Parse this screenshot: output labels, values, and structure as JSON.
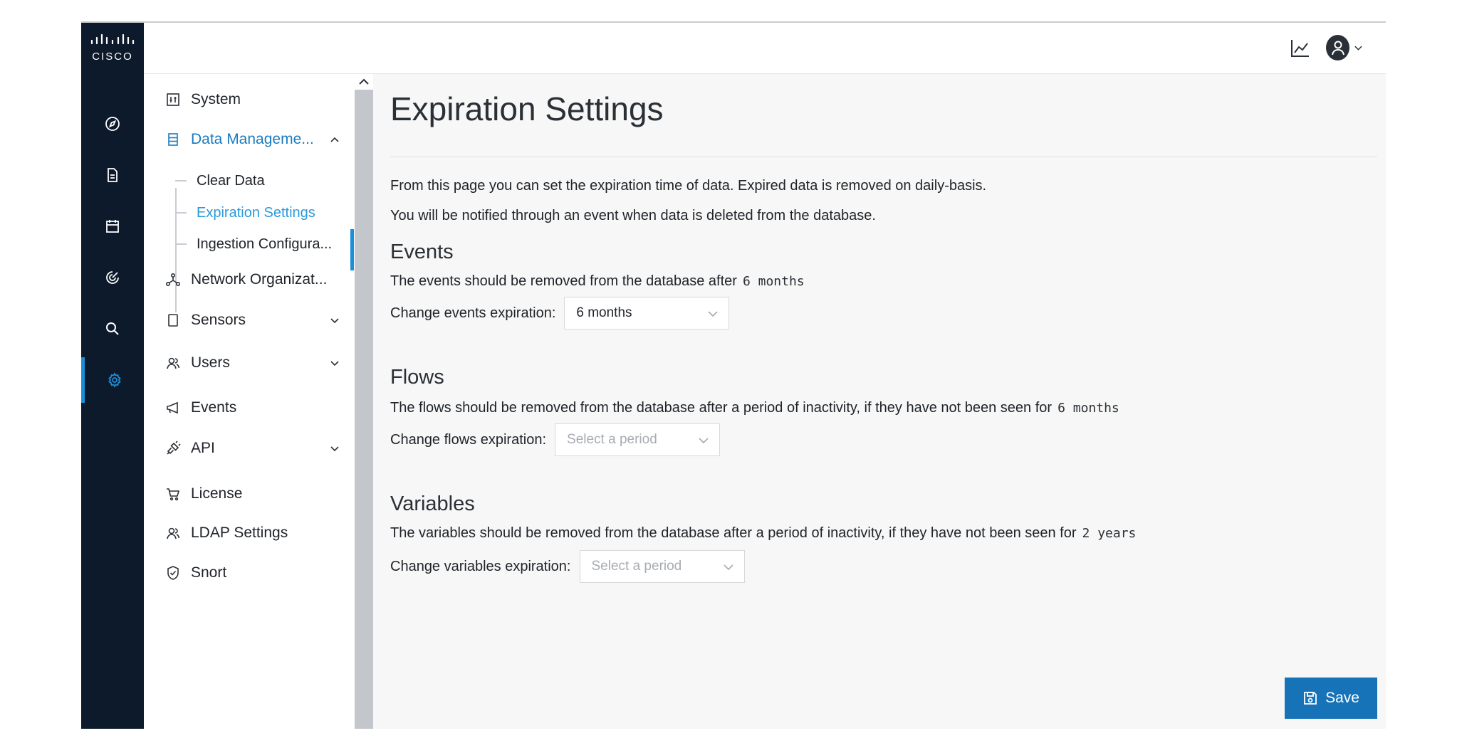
{
  "brand": {
    "name": "CISCO"
  },
  "rail": {
    "items": [
      {
        "icon": "compass-icon"
      },
      {
        "icon": "document-icon"
      },
      {
        "icon": "calendar-icon"
      },
      {
        "icon": "radar-icon"
      },
      {
        "icon": "search-icon"
      },
      {
        "icon": "gear-icon",
        "active": true
      }
    ]
  },
  "topbar": {
    "chart_icon": "line-chart-icon",
    "user_icon": "user-avatar-icon"
  },
  "nav": {
    "system": "System",
    "data_management": "Data Manageme...",
    "sub": {
      "clear_data": "Clear Data",
      "expiration_settings": "Expiration Settings",
      "ingestion": "Ingestion Configura..."
    },
    "network": "Network Organizat...",
    "sensors": "Sensors",
    "users": "Users",
    "events": "Events",
    "api": "API",
    "license": "License",
    "ldap": "LDAP Settings",
    "snort": "Snort"
  },
  "main": {
    "title": "Expiration Settings",
    "intro1": "From this page you can set the expiration time of data. Expired data is removed on daily-basis.",
    "intro2": "You will be notified through an event when data is deleted from the database.",
    "events": {
      "heading": "Events",
      "text": "The events should be removed from the database after",
      "current": "6 months",
      "label": "Change events expiration:",
      "value": "6 months"
    },
    "flows": {
      "heading": "Flows",
      "text": "The flows should be removed from the database after a period of inactivity, if they have not been seen for",
      "current": "6 months",
      "label": "Change flows expiration:",
      "placeholder": "Select a period"
    },
    "variables": {
      "heading": "Variables",
      "text": "The variables should be removed from the database after a period of inactivity, if they have not been seen for",
      "current": "2 years",
      "label": "Change variables expiration:",
      "placeholder": "Select a period"
    },
    "save_label": "Save"
  },
  "colors": {
    "rail_bg": "#0d1a2c",
    "accent": "#1a8fd8",
    "save_bg": "#1773b8"
  }
}
